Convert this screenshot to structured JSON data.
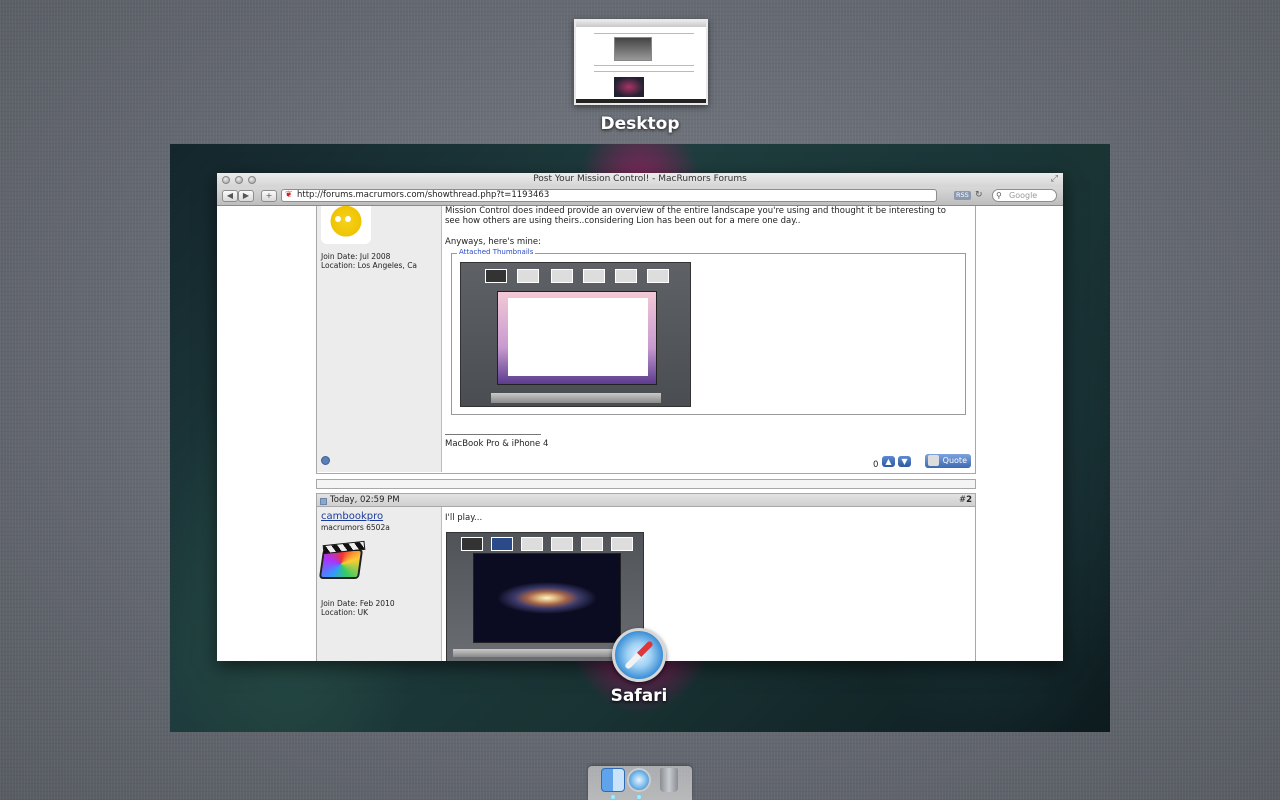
{
  "mission_control": {
    "desktop_label": "Desktop",
    "app_label": "Safari"
  },
  "safari": {
    "window_title": "Post Your Mission Control! - MacRumors Forums",
    "url": "http://forums.macrumors.com/showthread.php?t=1193463",
    "rss_label": "RSS",
    "search_placeholder": "Google",
    "add_label": "+",
    "back_label": "◀",
    "forward_label": "▶"
  },
  "post1": {
    "join_date": "Join Date: Jul 2008",
    "location": "Location: Los Angeles, Ca",
    "intro_line1": "Mission Control does indeed provide an overview of the entire landscape you're using and thought it be interesting to",
    "intro_line2": "see how others are using theirs..considering Lion has been out for a mere one day..",
    "anyways": "Anyways, here's mine:",
    "attached_legend": "Attached Thumbnails",
    "signature": "MacBook Pro & iPhone 4",
    "rep_count": "0",
    "quote_label": "Quote"
  },
  "post2": {
    "date": "Today, 02:59 PM",
    "number_prefix": "#",
    "number": "2",
    "username": "cambookpro",
    "user_title": "macrumors 6502a",
    "join_date": "Join Date: Feb 2010",
    "location": "Location: UK",
    "text": "I'll play..."
  },
  "icons": {
    "finder": "finder-icon",
    "safari": "safari-icon",
    "trash": "trash-icon",
    "online": "online-status-icon",
    "reload": "reload-icon",
    "search": "search-icon"
  },
  "colors": {
    "link_blue": "#1a3b9c",
    "legend_blue": "#2b4bc0",
    "quote_button": "#3d6ab2"
  }
}
